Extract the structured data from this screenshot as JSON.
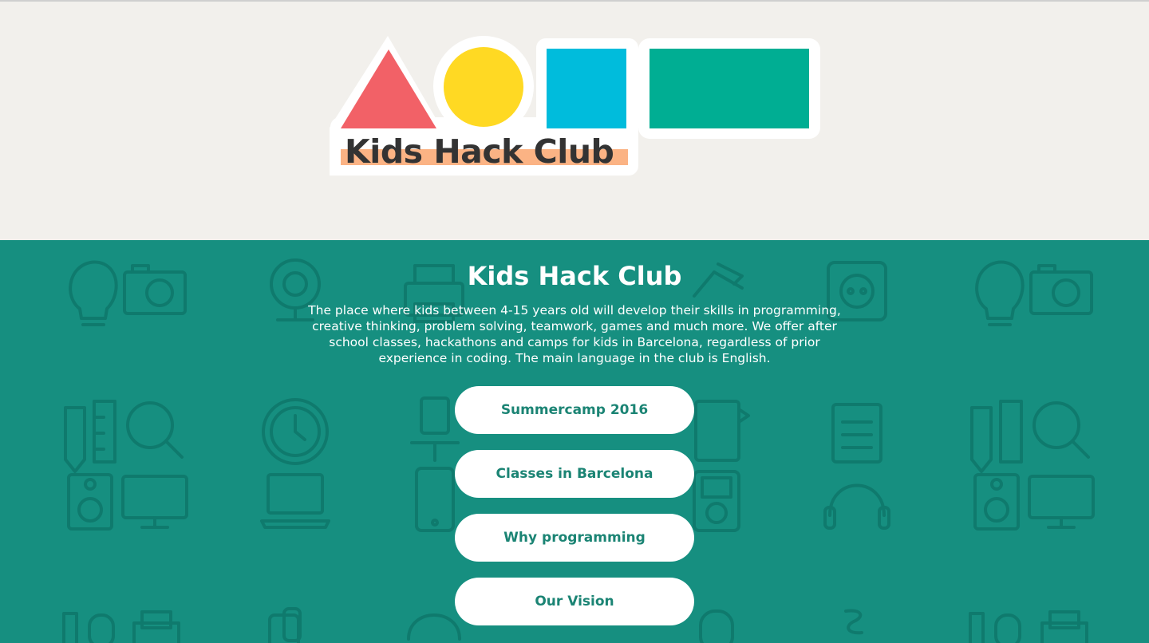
{
  "header": {
    "logo_text": "Kids Hack Club",
    "colors": {
      "triangle": "#f26167",
      "circle": "#ffd923",
      "square": "#00bcdc",
      "rectangle": "#00ae93",
      "underline": "#fbb384",
      "background": "#f2f0ec"
    }
  },
  "hero": {
    "title": "Kids Hack Club",
    "description": "The place where kids between 4-15 years old will develop their skills in programming, creative thinking, problem solving, teamwork, games and much more. We offer after school classes, hackathons and camps for kids in Barcelona, regardless of prior experience in coding. The main language in the club is English.",
    "background_color": "#168f80",
    "buttons": [
      {
        "label": "Summercamp 2016"
      },
      {
        "label": "Classes in Barcelona"
      },
      {
        "label": "Why programming"
      },
      {
        "label": "Our Vision"
      }
    ]
  }
}
